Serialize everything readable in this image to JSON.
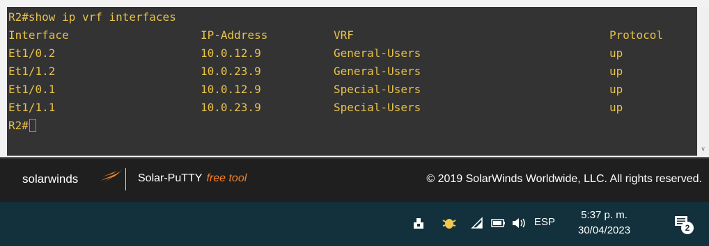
{
  "terminal": {
    "prompt_command": "R2#show ip vrf interfaces",
    "headers": [
      "Interface",
      "IP-Address",
      "VRF",
      "Protocol"
    ],
    "rows": [
      [
        "Et1/0.2",
        "10.0.12.9",
        "General-Users",
        "up"
      ],
      [
        "Et1/1.2",
        "10.0.23.9",
        "General-Users",
        "up"
      ],
      [
        "Et1/0.1",
        "10.0.12.9",
        "Special-Users",
        "up"
      ],
      [
        "Et1/1.1",
        "10.0.23.9",
        "Special-Users",
        "up"
      ]
    ],
    "prompt": "R2#",
    "text_color": "#e8c24a",
    "background": "#333333",
    "cursor_color": "#35d435"
  },
  "footer": {
    "brand": "solarwinds",
    "product": "Solar-PuTTY",
    "free_tool": "free tool",
    "copyright": "© 2019 SolarWinds Worldwide, LLC. All rights reserved.",
    "accent_color": "#f58025"
  },
  "taskbar": {
    "tray_icons": [
      "usb-eject-icon",
      "bug-app-icon",
      "wifi-icon",
      "battery-icon",
      "volume-icon"
    ],
    "language": "ESP",
    "time": "5:37 p. m.",
    "date": "30/04/2023",
    "notification_count": "2"
  }
}
